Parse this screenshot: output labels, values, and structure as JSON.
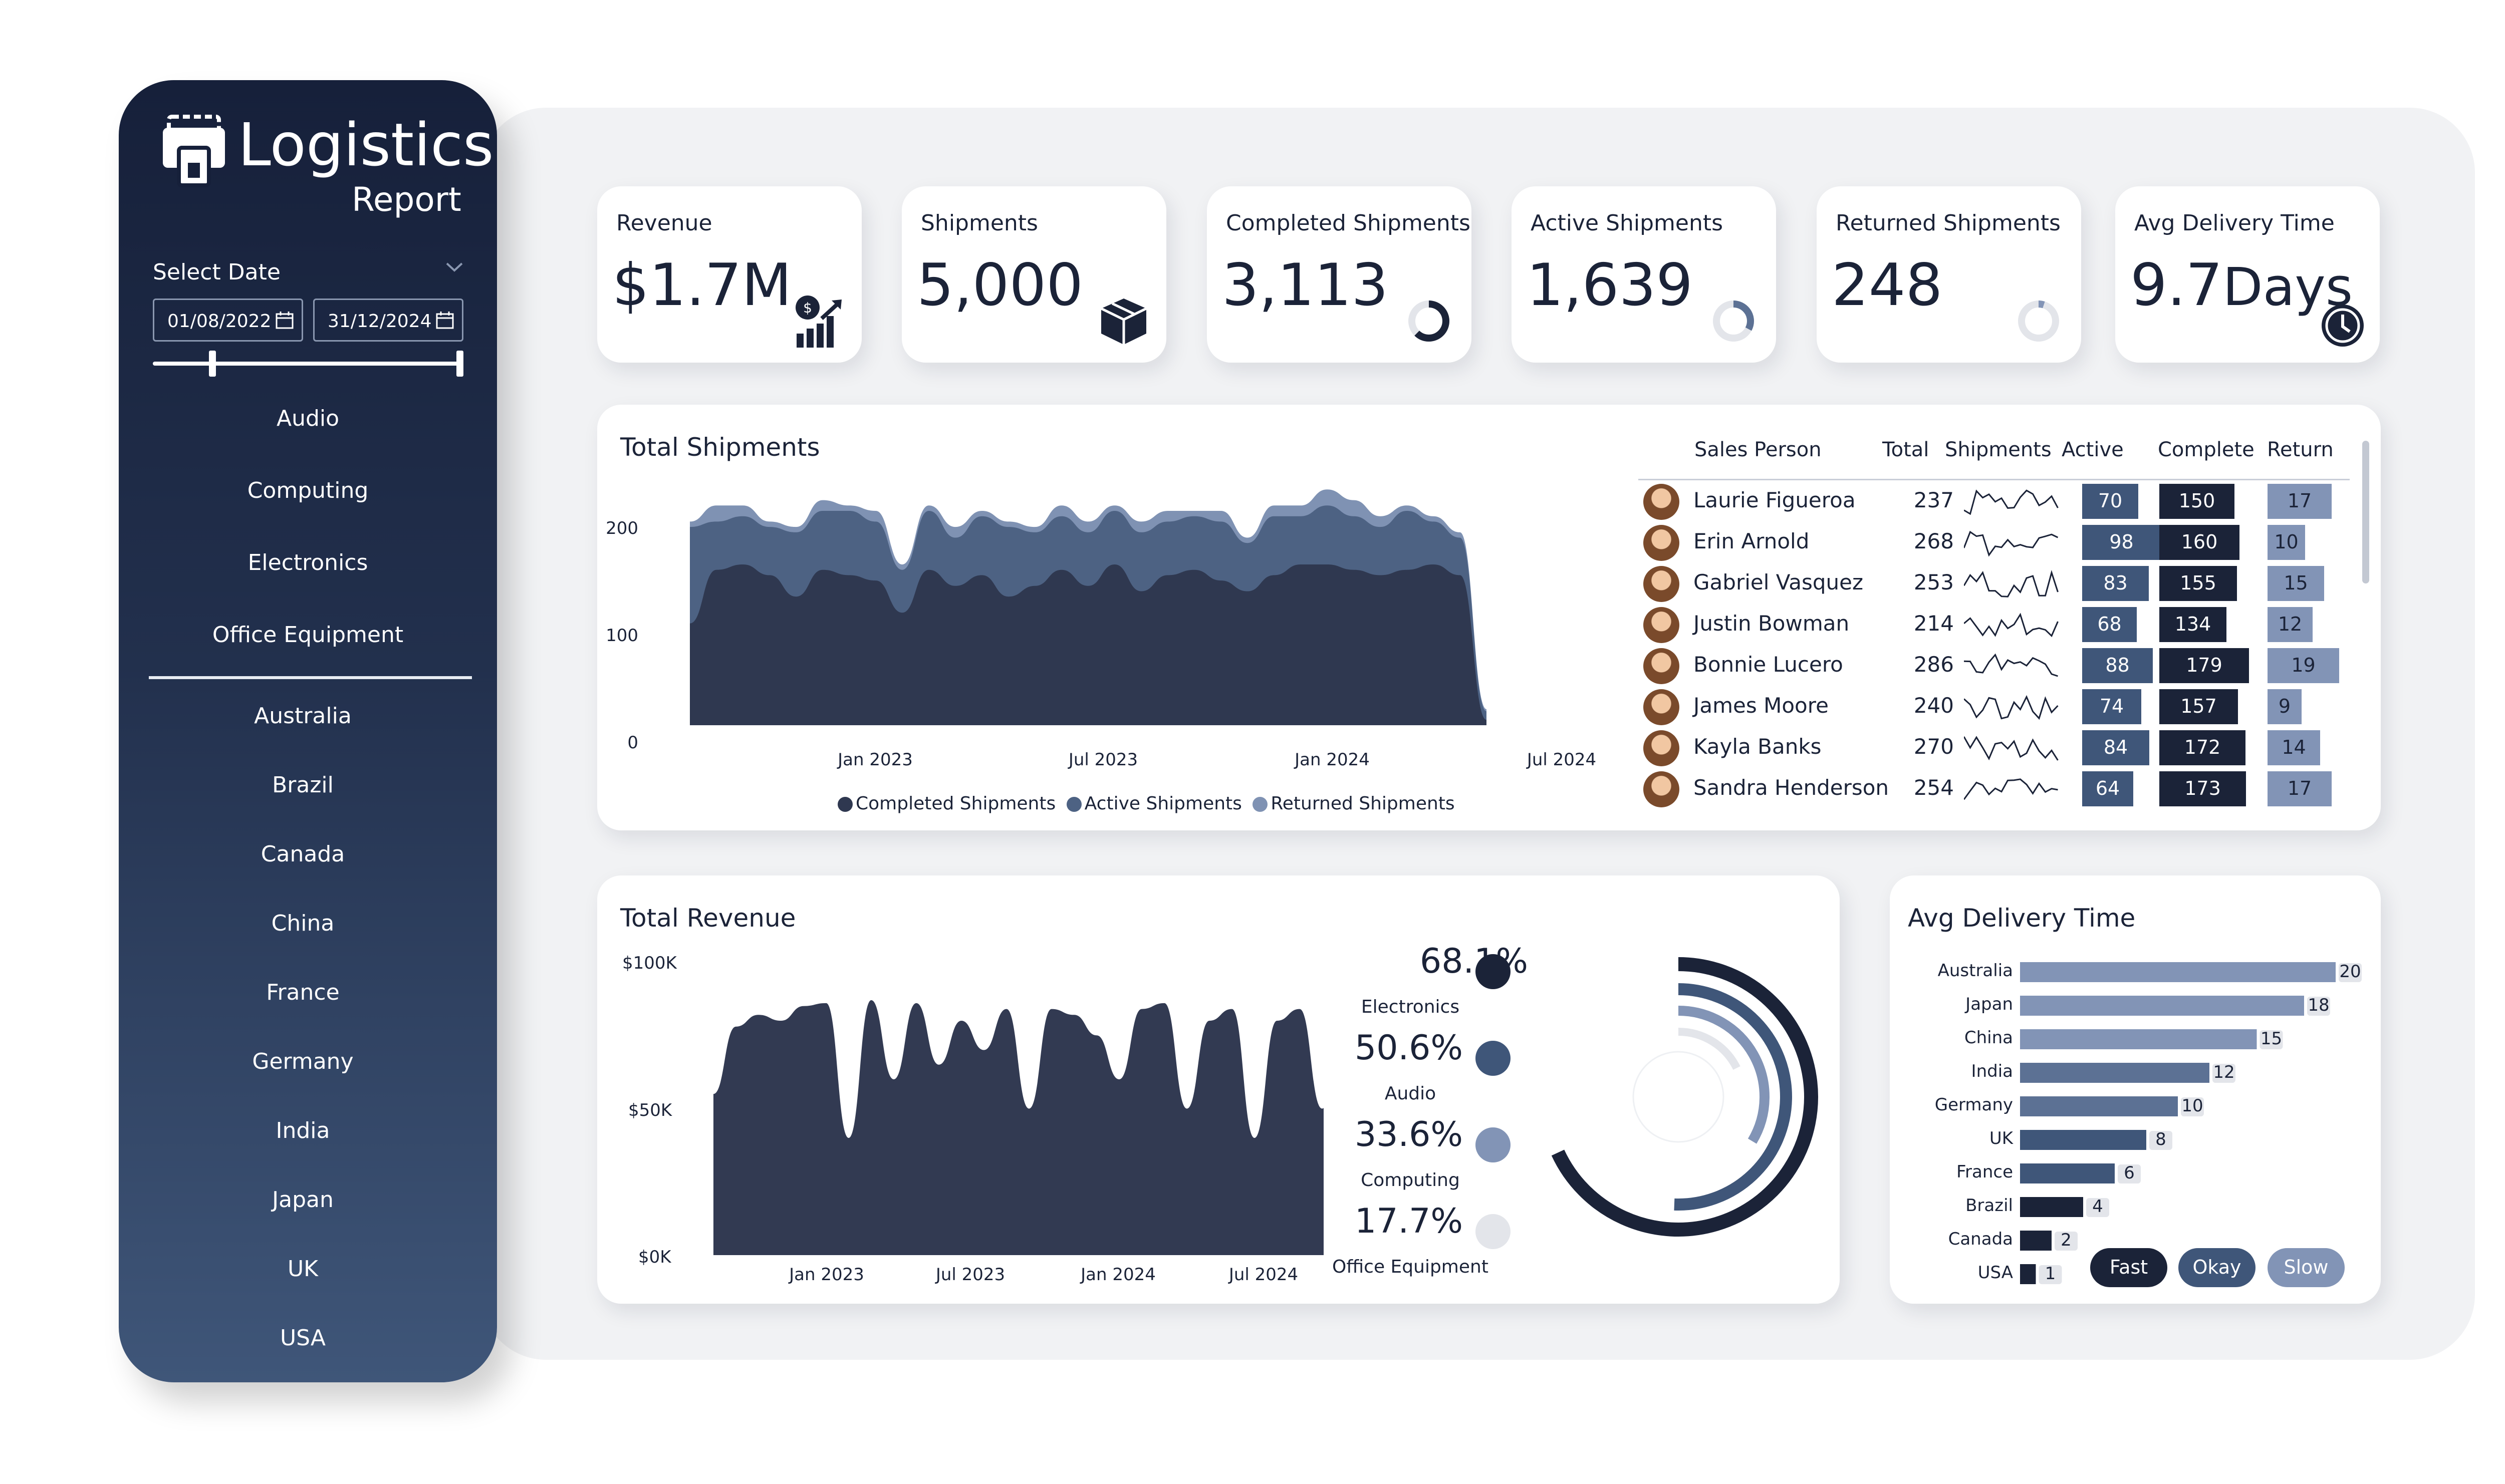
{
  "app": {
    "title": "Logistics",
    "subtitle": "Report"
  },
  "date_filter": {
    "label": "Select Date",
    "start": "01/08/2022",
    "end": "31/12/2024"
  },
  "categories": [
    "Audio",
    "Computing",
    "Electronics",
    "Office Equipment"
  ],
  "countries": [
    "Australia",
    "Brazil",
    "Canada",
    "China",
    "France",
    "Germany",
    "India",
    "Japan",
    "UK",
    "USA"
  ],
  "kpis": [
    {
      "label": "Revenue",
      "value": "$1.7M",
      "icon": "revenue-chart-icon"
    },
    {
      "label": "Shipments",
      "value": "5,000",
      "icon": "package-icon"
    },
    {
      "label": "Completed Shipments",
      "value": "3,113",
      "icon": "progress-ring-icon"
    },
    {
      "label": "Active Shipments",
      "value": "1,639",
      "icon": "progress-ring-icon"
    },
    {
      "label": "Returned Shipments",
      "value": "248",
      "icon": "progress-ring-icon"
    },
    {
      "label": "Avg Delivery Time",
      "value_num": "9.7",
      "value_unit": "Days",
      "icon": "clock-icon"
    }
  ],
  "total_shipments": {
    "title": "Total Shipments",
    "yticks": [
      "200",
      "100",
      "0"
    ],
    "xticks": [
      "Jan 2023",
      "Jul 2023",
      "Jan 2024",
      "Jul 2024"
    ],
    "legend": [
      "Completed Shipments",
      "Active Shipments",
      "Returned Shipments"
    ]
  },
  "sales_table": {
    "headers": [
      "Sales Person",
      "Total",
      "Shipments",
      "Active",
      "Complete",
      "Return"
    ],
    "rows": [
      {
        "name": "Laurie Figueroa",
        "total": "237",
        "active": "70",
        "complete": "150",
        "return": "17"
      },
      {
        "name": "Erin Arnold",
        "total": "268",
        "active": "98",
        "complete": "160",
        "return": "10"
      },
      {
        "name": "Gabriel Vasquez",
        "total": "253",
        "active": "83",
        "complete": "155",
        "return": "15"
      },
      {
        "name": "Justin Bowman",
        "total": "214",
        "active": "68",
        "complete": "134",
        "return": "12"
      },
      {
        "name": "Bonnie Lucero",
        "total": "286",
        "active": "88",
        "complete": "179",
        "return": "19"
      },
      {
        "name": "James Moore",
        "total": "240",
        "active": "74",
        "complete": "157",
        "return": "9"
      },
      {
        "name": "Kayla Banks",
        "total": "270",
        "active": "84",
        "complete": "172",
        "return": "14"
      },
      {
        "name": "Sandra Henderson",
        "total": "254",
        "active": "64",
        "complete": "173",
        "return": "17"
      }
    ]
  },
  "total_revenue": {
    "title": "Total Revenue",
    "yticks": [
      "$100K",
      "$50K",
      "$0K"
    ],
    "xticks": [
      "Jan 2023",
      "Jul 2023",
      "Jan 2024",
      "Jul 2024"
    ],
    "shares": [
      {
        "pct": "68.1%",
        "label": "Electronics",
        "color": "#1b2338"
      },
      {
        "pct": "50.6%",
        "label": "Audio",
        "color": "#3f5679"
      },
      {
        "pct": "33.6%",
        "label": "Computing",
        "color": "#8294b6"
      },
      {
        "pct": "17.7%",
        "label": "Office Equipment",
        "color": "#e3e5ea"
      }
    ]
  },
  "avg_delivery": {
    "title": "Avg Delivery Time",
    "buttons": [
      "Fast",
      "Okay",
      "Slow"
    ]
  },
  "chart_data": [
    {
      "type": "area",
      "title": "Total Shipments",
      "series": [
        {
          "name": "Completed Shipments",
          "color": "#2f3850"
        },
        {
          "name": "Active Shipments",
          "color": "#4d6283"
        },
        {
          "name": "Returned Shipments",
          "color": "#7f92b3"
        }
      ],
      "ylim": [
        0,
        250
      ],
      "x_range": [
        "Aug 2022",
        "Dec 2024"
      ],
      "completed": [
        95,
        145,
        150,
        140,
        120,
        145,
        140,
        135,
        105,
        145,
        130,
        140,
        120,
        130,
        145,
        130,
        150,
        125,
        140,
        145,
        135,
        125,
        140,
        150,
        150,
        145,
        140,
        145,
        150,
        140,
        5
      ],
      "active": [
        90,
        45,
        45,
        45,
        60,
        55,
        60,
        55,
        40,
        55,
        45,
        55,
        65,
        50,
        50,
        50,
        50,
        55,
        50,
        50,
        55,
        45,
        55,
        45,
        55,
        50,
        45,
        55,
        40,
        35,
        8
      ],
      "returned": [
        5,
        15,
        10,
        5,
        5,
        10,
        5,
        10,
        5,
        5,
        10,
        5,
        5,
        5,
        10,
        10,
        5,
        10,
        10,
        5,
        10,
        5,
        10,
        10,
        15,
        15,
        10,
        5,
        5,
        5,
        2
      ]
    },
    {
      "type": "area",
      "title": "Total Revenue",
      "series": [
        {
          "name": "",
          "color": "#323a52"
        }
      ],
      "ylim": [
        0,
        100000
      ],
      "values": [
        55000,
        78000,
        82000,
        80000,
        85000,
        86000,
        40000,
        87000,
        60000,
        86000,
        65000,
        80000,
        70000,
        84000,
        50000,
        84000,
        82000,
        75000,
        60000,
        84000,
        86000,
        50000,
        80000,
        84000,
        40000,
        80000,
        84000,
        50000,
        83000,
        78000,
        0
      ]
    },
    {
      "type": "pie",
      "title": "",
      "categories": [
        "Electronics",
        "Audio",
        "Computing",
        "Office Equipment"
      ],
      "values": [
        68.1,
        50.6,
        33.6,
        17.7
      ]
    },
    {
      "type": "bar",
      "title": "Avg Delivery Time",
      "categories": [
        "Australia",
        "Japan",
        "China",
        "India",
        "Germany",
        "UK",
        "France",
        "Brazil",
        "Canada",
        "USA"
      ],
      "values": [
        20,
        18,
        15,
        12,
        10,
        8,
        6,
        4,
        2,
        1
      ],
      "colors": [
        "#8294b6",
        "#8294b6",
        "#8294b6",
        "#5c7194",
        "#5c7194",
        "#3f5679",
        "#3f5679",
        "#1b2338",
        "#1b2338",
        "#1b2338"
      ],
      "xlim": [
        0,
        20
      ]
    }
  ]
}
